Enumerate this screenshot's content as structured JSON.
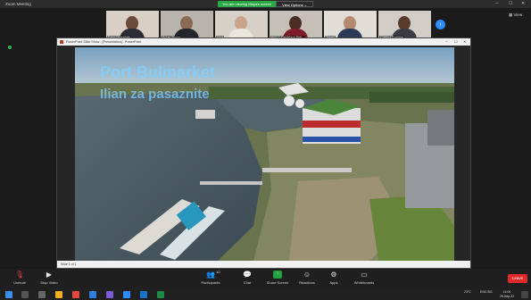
{
  "window": {
    "title": "Zoom Meeting",
    "view_label": "View"
  },
  "share_banner": {
    "viewing": "You are viewing Mapa's screen",
    "options": "View Options ⌄"
  },
  "participants": [
    {
      "name": "Farm Helsefolje"
    },
    {
      "name": "Bojan Bogov"
    },
    {
      "name": "Vera"
    },
    {
      "name": "BRCC Desislava Petr..."
    },
    {
      "name": "Tervet"
    },
    {
      "name": "Cristina Enalzee"
    }
  ],
  "powerpoint": {
    "title": "PowerPoint Slide Show - [Presentation] - PowerPoint",
    "status": "Slide 1 of 1",
    "slide": {
      "heading": "Port Bulmarket",
      "subheading": "Ilian za pasaznite"
    }
  },
  "toolbar": {
    "unmute": "Unmute",
    "stop_video": "Stop Video",
    "participants": "Participants",
    "participants_count": "10",
    "chat": "Chat",
    "share_screen": "Share Screen",
    "reactions": "Reactions",
    "apps": "Apps",
    "whiteboards": "Whiteboards",
    "leave": "Leave"
  },
  "taskbar": {
    "temperature": "23°C",
    "language": "ENG BG",
    "time": "14:00",
    "date": "29-Sep-22"
  },
  "colors": {
    "zoom_blue": "#2d8cff",
    "share_green": "#22a040",
    "leave_red": "#e02828"
  }
}
